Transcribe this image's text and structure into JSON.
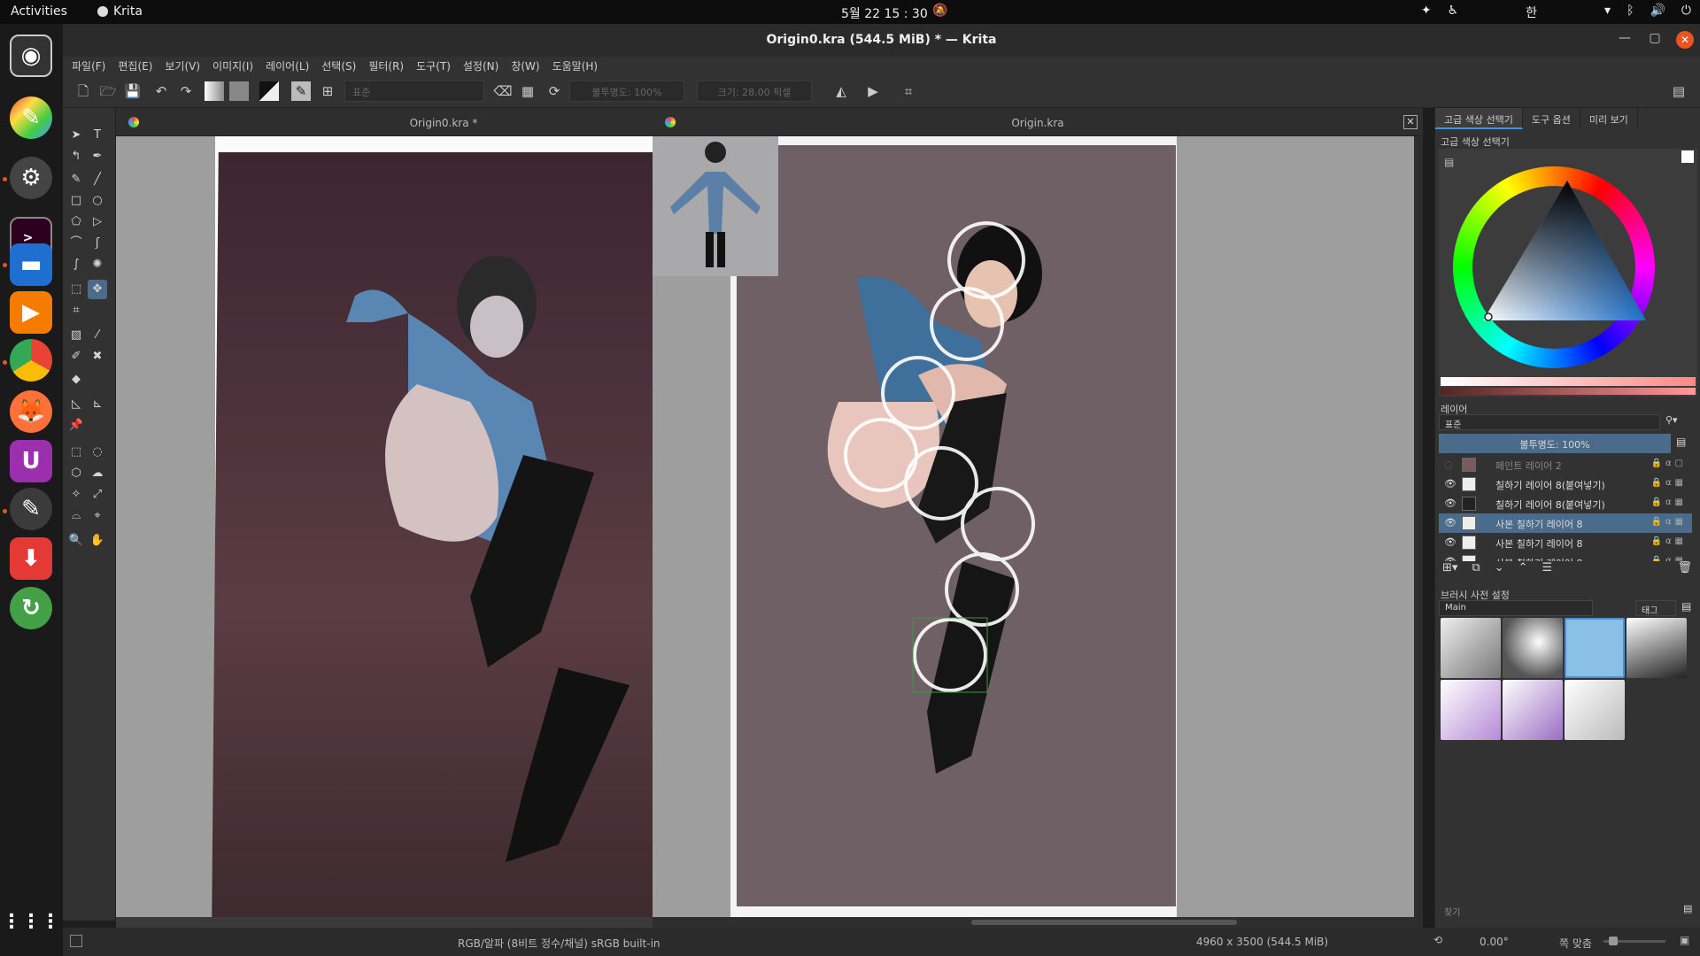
{
  "topbar": {
    "activities": "Activities",
    "app_name": "Krita",
    "clock": "5월 22  15 : 30",
    "keyboard_lang": "한"
  },
  "window": {
    "title": "Origin0.kra (544.5 MiB)  * — Krita"
  },
  "menu": [
    "파일(F)",
    "편집(E)",
    "보기(V)",
    "이미지(I)",
    "레이어(L)",
    "선택(S)",
    "필터(R)",
    "도구(T)",
    "설정(N)",
    "창(W)",
    "도움말(H)"
  ],
  "toolbar": {
    "blend_mode": "표준",
    "opacity": "불투명도: 100%",
    "size": "크기: 28.00 픽셀"
  },
  "views": {
    "left_tab": "Origin0.kra *",
    "right_tab": "Origin.kra"
  },
  "docker": {
    "tabs": [
      "고급 색상 선택기",
      "도구 옵션",
      "미리 보기"
    ],
    "color_title": "고급 색상 선택기",
    "layers_title": "레이어",
    "blend": "표준",
    "opacity": "불투명도:  100%",
    "layers": [
      {
        "name": "페인트 레이어 2",
        "visible": false,
        "selected": false
      },
      {
        "name": "칠하기 레이어 8(붙여넣기)",
        "visible": true,
        "selected": false
      },
      {
        "name": "칠하기 레이어 8(붙여넣기)",
        "visible": true,
        "selected": false
      },
      {
        "name": "사본 칠하기 레이어 8",
        "visible": true,
        "selected": true
      },
      {
        "name": "사본 칠하기 레이어 8",
        "visible": true,
        "selected": false
      },
      {
        "name": "사본 칠하기 레이어 8",
        "visible": true,
        "selected": false
      }
    ],
    "brush_title": "브러시 사전 설정",
    "brush_group": "Main",
    "tag_label": "태그",
    "search_placeholder": "찾기"
  },
  "statusbar": {
    "color_profile": "RGB/알파 (8비트 정수/채널)  sRGB built-in",
    "dimensions": "4960 x 3500 (544.5 MiB)",
    "rotation": "0.00°",
    "zoom": "쪽 맞춤"
  },
  "colors": {
    "accent": "#e95420",
    "selection": "#4a6b8a",
    "panel": "#323232"
  }
}
